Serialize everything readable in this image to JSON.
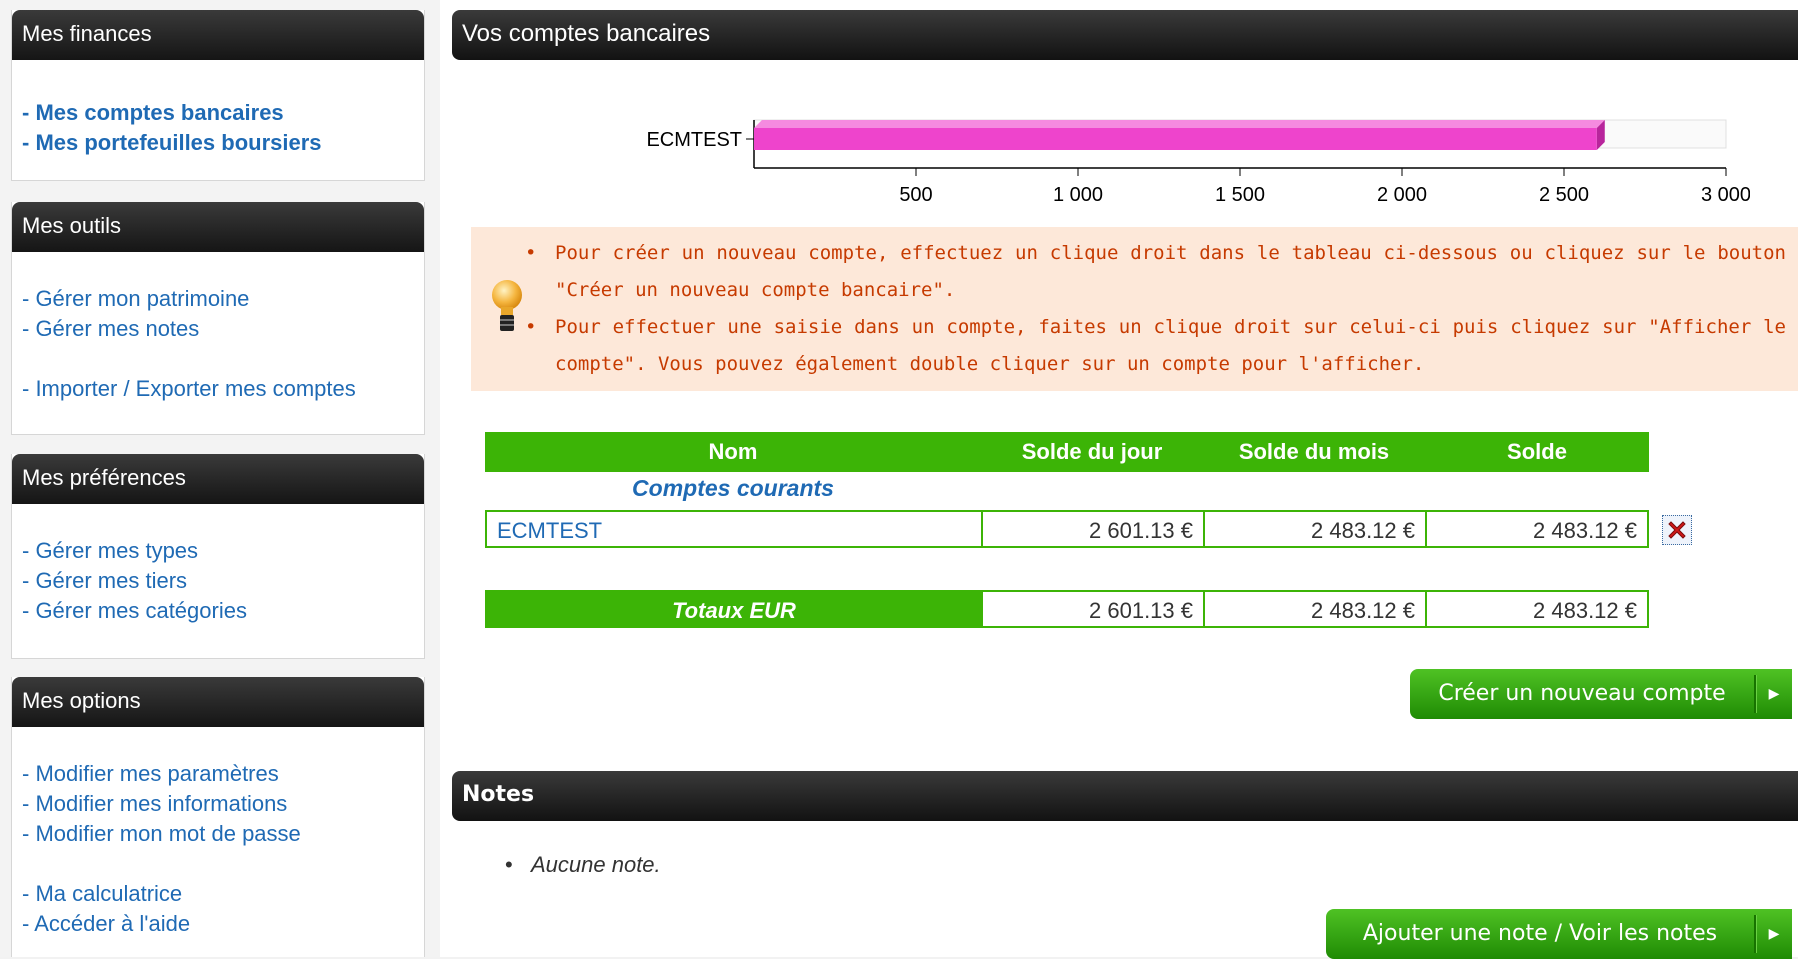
{
  "sidebar": {
    "finances": {
      "title": "Mes finances",
      "links": [
        "- Mes comptes bancaires",
        "- Mes portefeuilles boursiers"
      ]
    },
    "outils": {
      "title": "Mes outils",
      "links": [
        "- Gérer mon patrimoine",
        "- Gérer mes notes",
        "- Importer / Exporter mes comptes"
      ]
    },
    "preferences": {
      "title": "Mes préférences",
      "links": [
        "- Gérer mes types",
        "- Gérer mes tiers",
        "- Gérer mes catégories"
      ]
    },
    "options": {
      "title": "Mes options",
      "links": [
        "- Modifier mes paramètres",
        "- Modifier mes informations",
        "- Modifier mon mot de passe",
        "- Ma calculatrice",
        "- Accéder à l'aide"
      ]
    }
  },
  "main": {
    "title": "Vos comptes bancaires",
    "tips": [
      "Pour créer un nouveau compte, effectuez un clique droit dans le tableau ci-dessous ou cliquez sur le bouton \"Créer un nouveau compte bancaire\".",
      "Pour effectuer une saisie dans un compte, faites un clique droit sur celui-ci puis cliquez sur \"Afficher le compte\". Vous pouvez également double cliquer sur un compte pour l'afficher."
    ],
    "table": {
      "headers": [
        "Nom",
        "Solde du jour",
        "Solde du mois",
        "Solde"
      ],
      "group": "Comptes courants",
      "rows": [
        {
          "name": "ECMTEST",
          "jour": "2 601.13 €",
          "mois": "2 483.12 €",
          "solde": "2 483.12 €"
        }
      ],
      "totals": {
        "label": "Totaux EUR",
        "jour": "2 601.13 €",
        "mois": "2 483.12 €",
        "solde": "2 483.12 €"
      }
    },
    "create_button": "Créer un nouveau compte"
  },
  "notes": {
    "title": "Notes",
    "items": [
      "Aucune note."
    ],
    "button": "Ajouter une note / Voir les notes"
  },
  "chart_data": {
    "type": "bar",
    "orientation": "horizontal",
    "categories": [
      "ECMTEST"
    ],
    "values": [
      2601.13
    ],
    "xticks": [
      "500",
      "1 000",
      "1 500",
      "2 000",
      "2 500",
      "3 000"
    ],
    "xlim": [
      0,
      3000
    ],
    "color": "#ee44cc"
  },
  "colors": {
    "accent_green": "#3cb406",
    "link_blue": "#1f6ab4",
    "tip_text": "#c63a00",
    "tip_bg": "#fde8d9"
  }
}
